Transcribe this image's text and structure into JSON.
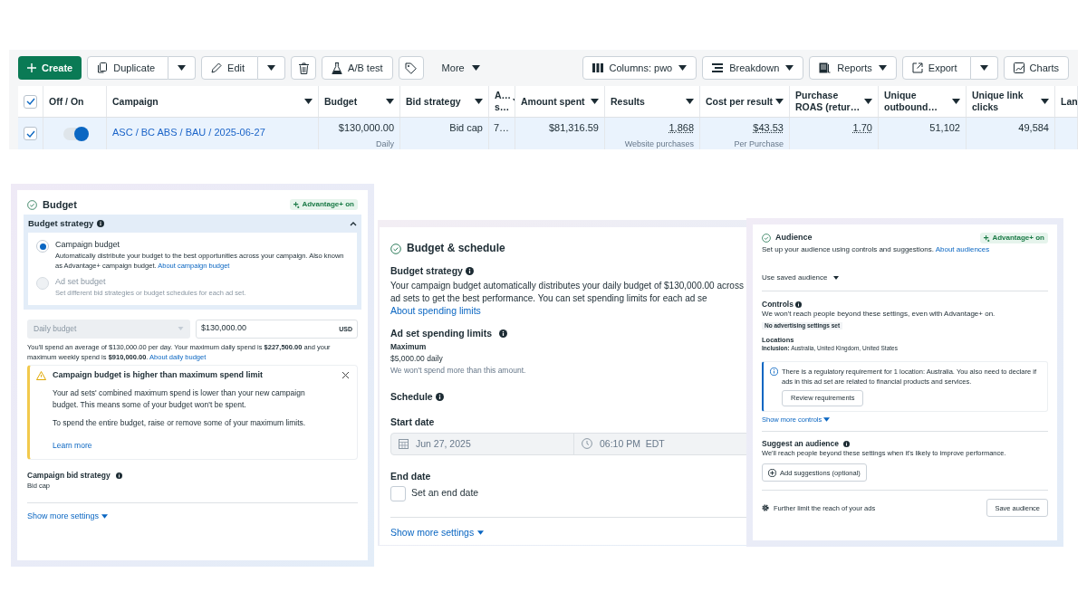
{
  "toolbar": {
    "left": [
      {
        "kind": "primary",
        "label": "Create"
      },
      {
        "kind": "split",
        "label": "Duplicate"
      },
      {
        "kind": "split",
        "label": "Edit"
      },
      {
        "kind": "icon"
      },
      {
        "kind": "plain",
        "label": "A/B test"
      },
      {
        "kind": "icon"
      },
      {
        "kind": "menu",
        "label": "More"
      }
    ],
    "right": [
      {
        "kind": "dropdown",
        "label": "Columns: pwo"
      },
      {
        "kind": "dropdown",
        "label": "Breakdown"
      },
      {
        "kind": "dropdown",
        "label": "Reports"
      },
      {
        "kind": "split",
        "label": "Export"
      },
      {
        "kind": "plain",
        "label": "Charts"
      }
    ]
  },
  "table": {
    "all_checked": true,
    "columns": [
      {
        "label": "Off / On",
        "sort": false
      },
      {
        "label": "Campaign",
        "sort": true
      },
      {
        "label": "Budget",
        "sort": true
      },
      {
        "label": "Bid strategy",
        "sort": true
      },
      {
        "label": "A… s…",
        "sort": true
      },
      {
        "label": "Amount spent",
        "sort": true
      },
      {
        "label": "Results",
        "sort": true
      },
      {
        "label": "Cost per result",
        "sort": true
      },
      {
        "label": "Purchase ROAS (retur…",
        "sort": true
      },
      {
        "label": "Unique outbound…",
        "sort": true
      },
      {
        "label": "Unique link clicks",
        "sort": true
      },
      {
        "label": "Lan",
        "sort": false
      }
    ],
    "rows": [
      {
        "checked": true,
        "selected": true,
        "cells": [
          {
            "kind": "toggle",
            "on": true
          },
          {
            "kind": "link",
            "value": "ASC / BC ABS / BAU / 2025-06-27"
          },
          {
            "value": "$130,000.00",
            "sub": "Daily"
          },
          {
            "value": "Bid cap"
          },
          {
            "value": "7…"
          },
          {
            "value": "$81,316.59"
          },
          {
            "value": "1,868",
            "sub": "Website purchases",
            "dotted": true
          },
          {
            "value": "$43.53",
            "sub": "Per Purchase",
            "dotted": true
          },
          {
            "value": "1.70",
            "dotted": true
          },
          {
            "value": "51,102"
          },
          {
            "value": "49,584"
          }
        ]
      }
    ]
  },
  "budget_panel": {
    "title": "Budget",
    "badge": "Advantage+ on",
    "strategy": {
      "title": "Budget strategy",
      "expanded": true,
      "options": [
        {
          "label": "Campaign budget",
          "description": "Automatically distribute your budget to the best opportunities across your campaign. Also known as Advantage+ campaign budget.",
          "link": "About campaign budget",
          "selected": true,
          "disabled": false
        },
        {
          "label": "Ad set budget",
          "description": "Set different bid strategies or budget schedules for each ad set.",
          "selected": false,
          "disabled": true
        }
      ]
    },
    "budget_type": {
      "value": "Daily budget",
      "disabled": true
    },
    "amount": {
      "value": "$130,000.00",
      "currency": "USD"
    },
    "note": "You'll spend an average of $130,000.00 per day. Your maximum daily spend is **$227,500.00** and your maximum weekly spend is **$910,000.00**.",
    "note_link": "About daily budget",
    "warning": {
      "title": "Campaign budget is higher than maximum spend limit",
      "paragraphs": [
        "Your ad sets' combined maximum spend is lower than your new campaign budget. This means some of your budget won't be spent.",
        "To spend the entire budget, raise or remove some of your maximum limits."
      ],
      "link": "Learn more"
    },
    "bid_strategy": {
      "label": "Campaign bid strategy",
      "value": "Bid cap"
    },
    "more": "Show more settings"
  },
  "schedule_panel": {
    "title": "Budget & schedule",
    "strategy_title": "Budget strategy",
    "strategy_text": "Your campaign budget automatically distributes your daily budget of $130,000.00 across ad sets to get the best performance. You can set spending limits for each ad se",
    "strategy_link": "About spending limits",
    "limits_title": "Ad set spending limits",
    "limits_label": "Maximum",
    "limits_value": "$5,000.00 daily",
    "limits_note": "We won't spend more than this amount.",
    "schedule_title": "Schedule",
    "start_label": "Start date",
    "start_date": "Jun 27, 2025",
    "start_time": "06:10 PM  EDT",
    "end_label": "End date",
    "end_checkbox": {
      "label": "Set an end date",
      "checked": false
    },
    "more": "Show more settings"
  },
  "audience_panel": {
    "title": "Audience",
    "badge": "Advantage+ on",
    "description": "Set up your audience using controls and suggestions.",
    "description_link": "About audiences",
    "saved": "Use saved audience",
    "controls_title": "Controls",
    "controls_text": "We won't reach people beyond these settings, even with Advantage+ on.",
    "controls_tag": "No advertising settings set",
    "locations_title": "Locations",
    "locations_text": "**Inclusion:** Australia, United Kingdom, United States",
    "info": {
      "text": "There is a regulatory requirement for 1 location: Australia. You also need to declare if ads in this ad set are related to financial products and services.",
      "button": "Review requirements"
    },
    "more_controls": "Show more controls",
    "suggest_title": "Suggest an audience",
    "suggest_text": "We'll reach people beyond these settings when it's likely to improve performance.",
    "suggest_button": "Add suggestions (optional)",
    "limit_text": "Further limit the reach of your ads",
    "save_button": "Save audience"
  }
}
